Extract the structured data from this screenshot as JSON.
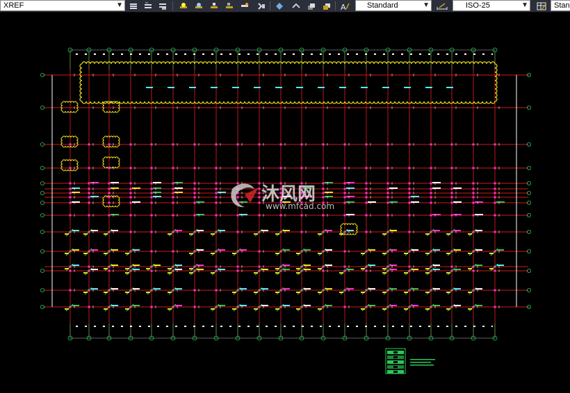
{
  "toolbar": {
    "xref_combo": "XREF",
    "text_style_combo": "Standard",
    "dim_style_combo": "ISO-25",
    "table_style_combo": "Stan",
    "icons": [
      "layer-state-icon",
      "layer-previous-icon",
      "layer-iso-icon",
      "layer-off-icon",
      "layer-freeze-icon",
      "layer-lock-icon",
      "layer-unlock-icon",
      "match-layer-icon",
      "layer-walk-icon",
      "copy-objects-icon",
      "isolate-icon",
      "draw-order-front-icon",
      "draw-order-back-icon",
      "text-style-icon",
      "dim-style-icon",
      "table-style-icon"
    ]
  },
  "watermark": {
    "brand": "沐风网",
    "url": "www.mfcad.com"
  },
  "colors": {
    "background": "#000000",
    "grid_red": "#d11a1a",
    "axis_green": "#29c75a",
    "cloud_yellow": "#f2e21a",
    "cyan": "#4ff0ff",
    "magenta": "#ff2fd8",
    "white": "#ffffff"
  }
}
